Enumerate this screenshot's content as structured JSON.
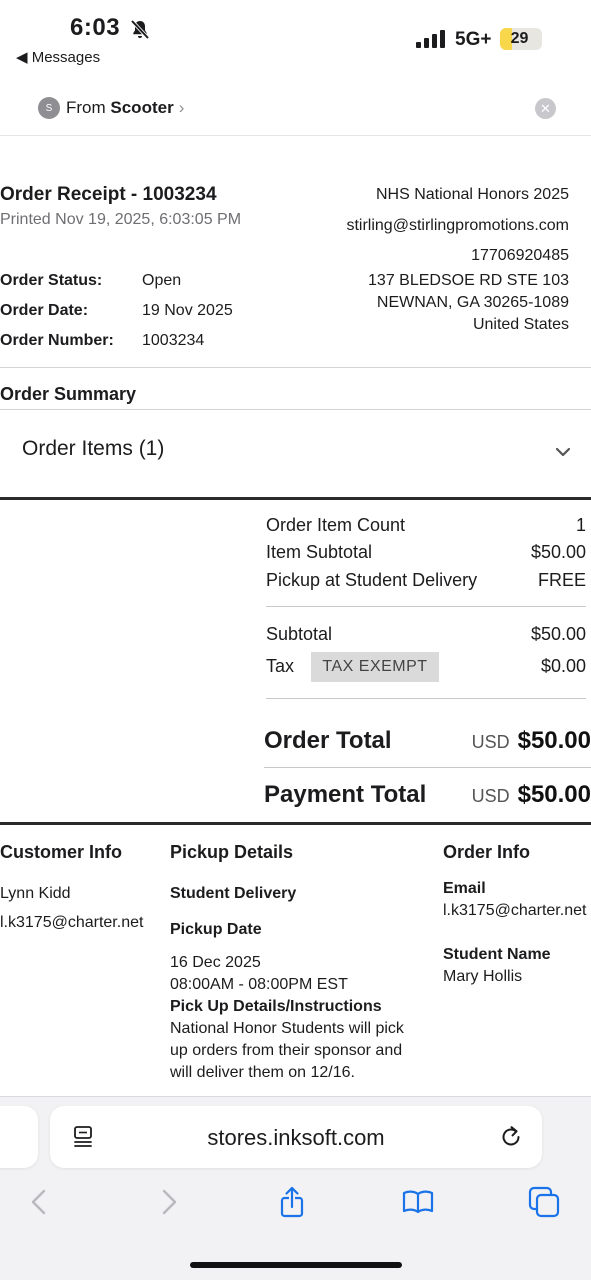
{
  "status_bar": {
    "time": "6:03",
    "back_label": "◀ Messages",
    "network": "5G+",
    "battery_level": "29",
    "battery_fraction": 0.29,
    "battery_color": "#f8d84a"
  },
  "message_banner": {
    "avatar_initial": "S",
    "from_prefix": "From ",
    "sender": "Scooter",
    "chevron": "›",
    "close_glyph": "✕"
  },
  "receipt": {
    "title": "Order Receipt - 1003234",
    "printed": "Printed Nov 19, 2025, 6:03:05 PM",
    "status_label": "Order Status:",
    "status_value": "Open",
    "date_label": "Order Date:",
    "date_value": "19 Nov 2025",
    "number_label": "Order Number:",
    "number_value": "1003234"
  },
  "store": {
    "name": "NHS National Honors 2025",
    "email": "stirling@stirlingpromotions.com",
    "phone": "17706920485",
    "address_line1": "137 BLEDSOE RD STE 103",
    "address_line2": "NEWNAN, GA 30265-1089",
    "country": "United States"
  },
  "summary": {
    "heading": "Order Summary",
    "items_heading": "Order Items (1)"
  },
  "totals": {
    "item_count_label": "Order Item Count",
    "item_count_value": "1",
    "item_subtotal_label": "Item Subtotal",
    "item_subtotal_value": "$50.00",
    "pickup_label": "Pickup at Student Delivery",
    "pickup_value": "FREE",
    "subtotal_label": "Subtotal",
    "subtotal_value": "$50.00",
    "tax_label": "Tax",
    "tax_badge": "TAX EXEMPT",
    "tax_value": "$0.00",
    "order_total_label": "Order Total",
    "order_total_currency": "USD",
    "order_total_value": "$50.00",
    "payment_total_label": "Payment Total",
    "payment_total_currency": "USD",
    "payment_total_value": "$50.00"
  },
  "customer": {
    "heading": "Customer Info",
    "name": "Lynn Kidd",
    "email": "l.k3175@charter.net"
  },
  "pickup": {
    "heading": "Pickup Details",
    "method": "Student Delivery",
    "date_label": "Pickup Date",
    "date": "16 Dec 2025",
    "time": "08:00AM - 08:00PM EST",
    "instructions_label": "Pick Up Details/Instructions",
    "instructions_line1": "National Honor Students will pick",
    "instructions_line2": "up orders from their sponsor and",
    "instructions_line3": "will deliver them on 12/16."
  },
  "order_info": {
    "heading": "Order Info",
    "email_label": "Email",
    "email": "l.k3175@charter.net",
    "student_label": "Student Name",
    "student": "Mary Hollis"
  },
  "browser": {
    "url": "stores.inksoft.com",
    "accent_color": "#1a73e8",
    "disabled_color": "#b8b8bd"
  }
}
